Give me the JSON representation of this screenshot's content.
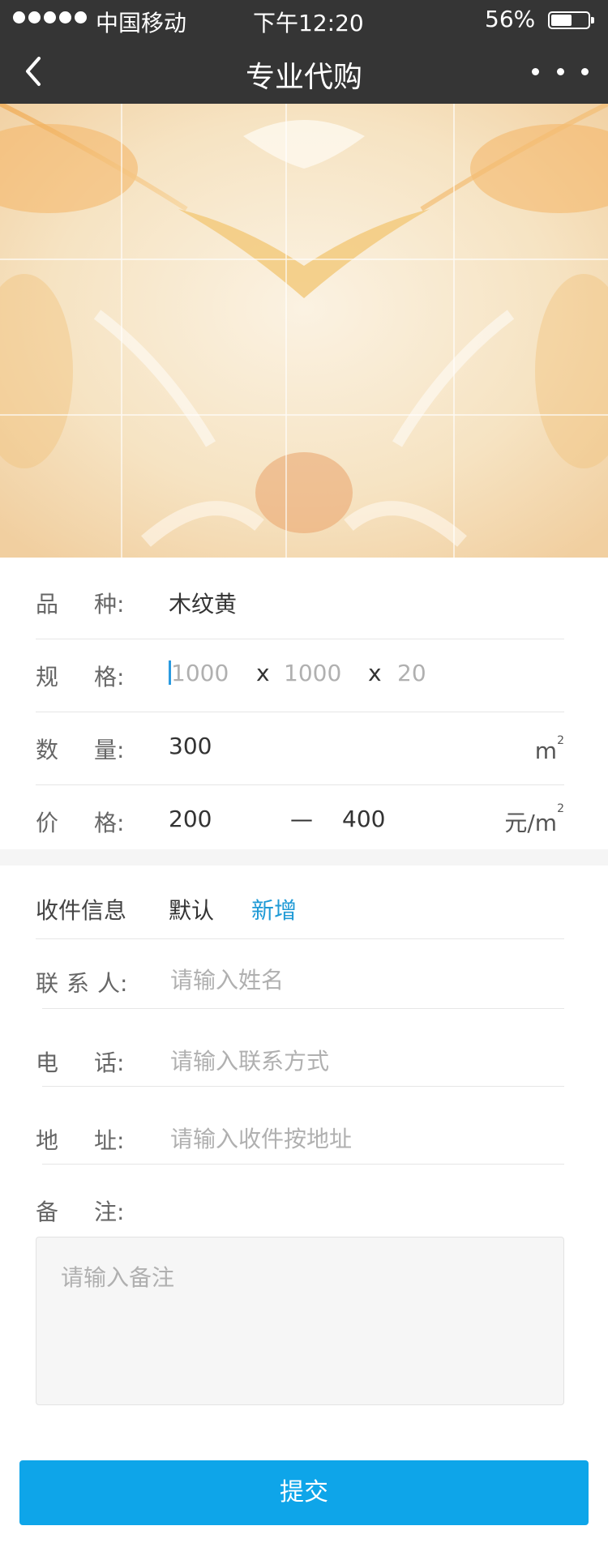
{
  "status_bar": {
    "carrier": "中国移动",
    "time": "下午12:20",
    "battery_percent": "56%",
    "battery_level": 0.56
  },
  "nav": {
    "title": "专业代购"
  },
  "product": {
    "variety": {
      "label": [
        "品",
        "种:"
      ],
      "value": "木纹黄"
    },
    "spec": {
      "label": [
        "规",
        "格:"
      ],
      "length": "1000",
      "width": "1000",
      "thickness": "20",
      "separator": "x"
    },
    "quantity": {
      "label": [
        "数",
        "量:"
      ],
      "value": "300",
      "unit": "m",
      "unit_sup": "2"
    },
    "price": {
      "label": [
        "价",
        "格:"
      ],
      "min": "200",
      "dash": "—",
      "max": "400",
      "unit": "元/m",
      "unit_sup": "2"
    }
  },
  "shipping": {
    "title": "收件信息",
    "default_label": "默认",
    "add_label": "新增",
    "contact": {
      "label": [
        "联",
        "系",
        "人:"
      ],
      "placeholder": "请输入姓名"
    },
    "phone": {
      "label": [
        "电",
        "话:"
      ],
      "placeholder": "请输入联系方式"
    },
    "address": {
      "label": [
        "地",
        "址:"
      ],
      "placeholder": "请输入收件按地址"
    },
    "remark": {
      "label": [
        "备",
        "注:"
      ],
      "placeholder": "请输入备注"
    }
  },
  "submit_label": "提交",
  "colors": {
    "bar": "#353535",
    "accent": "#0ea5e9",
    "link": "#1f9ad6"
  }
}
